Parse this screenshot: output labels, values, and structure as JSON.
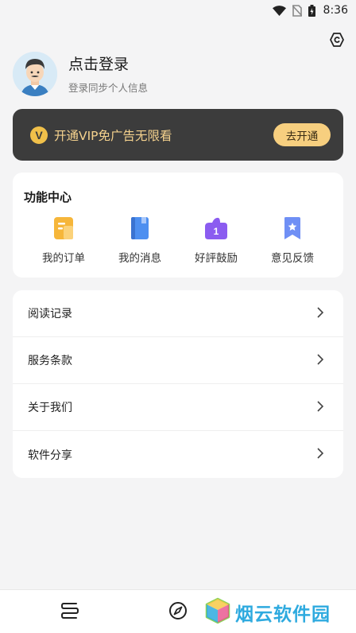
{
  "status_bar": {
    "time": "8:36"
  },
  "profile": {
    "title": "点击登录",
    "subtitle": "登录同步个人信息"
  },
  "vip": {
    "badge": "V",
    "text": "开通VIP免广告无限看",
    "button": "去开通"
  },
  "functions": {
    "title": "功能中心",
    "items": [
      {
        "label": "我的订单",
        "icon": "order-icon",
        "color": "#f6b63a"
      },
      {
        "label": "我的消息",
        "icon": "message-icon",
        "color": "#4d8ff0"
      },
      {
        "label": "好評鼓励",
        "icon": "rating-icon",
        "color": "#8b5cf0",
        "badge": "1"
      },
      {
        "label": "意见反馈",
        "icon": "feedback-icon",
        "color": "#6f8ff5"
      }
    ]
  },
  "menu": [
    {
      "label": "阅读记录"
    },
    {
      "label": "服务条款"
    },
    {
      "label": "关于我们"
    },
    {
      "label": "软件分享"
    }
  ],
  "bottom_nav": {
    "tabs": [
      "bookshelf-icon",
      "compass-icon"
    ]
  },
  "watermark": {
    "text": "烟云软件园"
  },
  "colors": {
    "vip_bg": "#3c3c3c",
    "vip_accent": "#f7cf7f",
    "brand": "#2eaadf"
  }
}
